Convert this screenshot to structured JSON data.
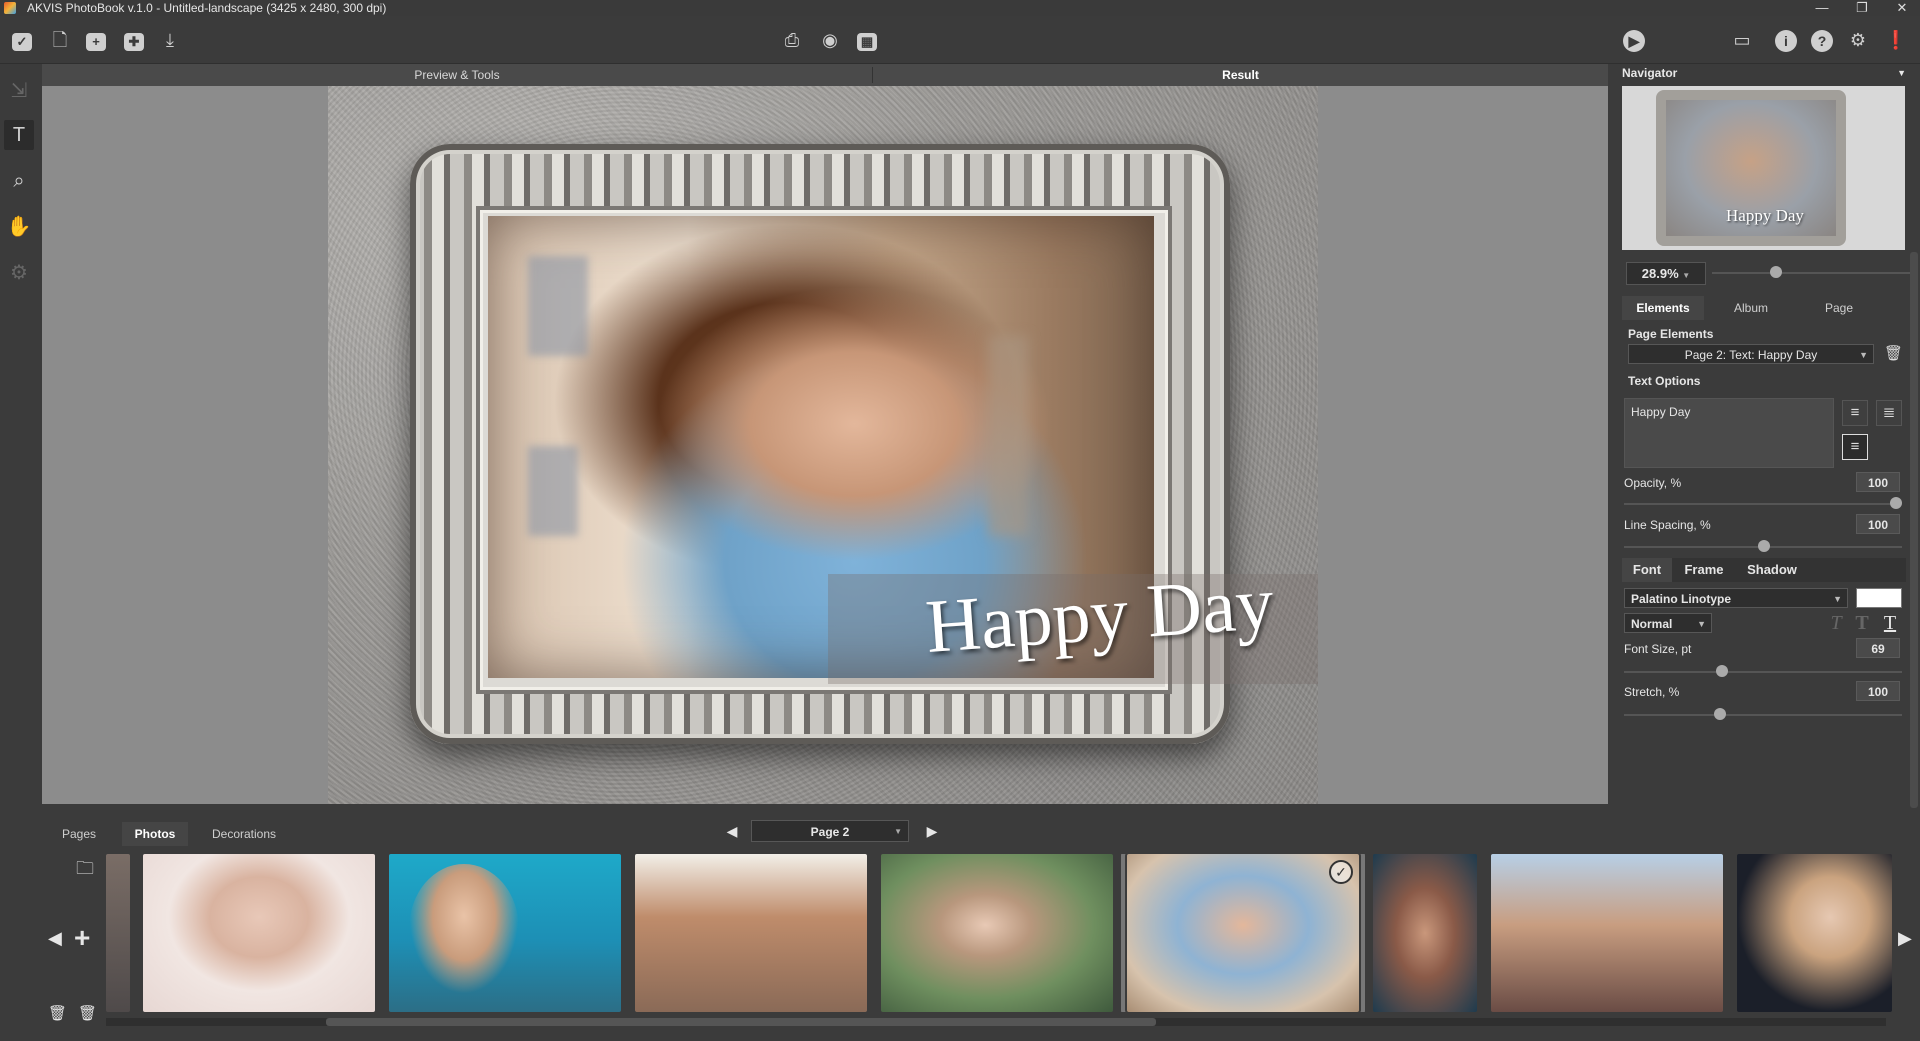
{
  "window": {
    "title": "AKVIS PhotoBook v.1.0 - Untitled-landscape (3425 x 2480, 300 dpi)",
    "minimize": "—",
    "maximize": "❐",
    "close": "✕"
  },
  "toolbar": {
    "left_icons": [
      "akvis-logo-icon",
      "new-document-icon",
      "add-photo-icon",
      "add-decoration-icon",
      "export-icon"
    ],
    "center_icons": [
      "print-icon",
      "preview-icon",
      "book-icon"
    ],
    "right_icons": [
      "run-icon",
      "panels-icon",
      "info-icon",
      "help-icon",
      "settings-icon",
      "notification-icon"
    ]
  },
  "left_tools": [
    "select-tool-icon",
    "text-tool-icon",
    "zoom-tool-icon",
    "hand-tool-icon",
    "gear-tool-icon"
  ],
  "workspace": {
    "tab_preview": "Preview & Tools",
    "tab_result": "Result",
    "caption_text": "Happy Day"
  },
  "navigator": {
    "title": "Navigator",
    "thumb_caption": "Happy Day",
    "zoom": "28.9%"
  },
  "panel": {
    "tabs": [
      "Elements",
      "Album",
      "Page"
    ],
    "page_elements_label": "Page Elements",
    "page_elements_value": "Page 2: Text: Happy Day",
    "text_options_label": "Text Options",
    "text_value": "Happy Day",
    "opacity_label": "Opacity, %",
    "opacity_value": "100",
    "line_spacing_label": "Line Spacing, %",
    "line_spacing_value": "100",
    "subtabs": [
      "Font",
      "Frame",
      "Shadow"
    ],
    "font_family": "Palatino Linotype",
    "font_style": "Normal",
    "font_color": "#ffffff",
    "font_size_label": "Font Size, pt",
    "font_size_value": "69",
    "stretch_label": "Stretch, %",
    "stretch_value": "100",
    "style_glyphs": [
      "T",
      "T",
      "T"
    ]
  },
  "bottom": {
    "tabs": [
      "Pages",
      "Photos",
      "Decorations"
    ],
    "page_selector": "Page 2",
    "prev": "◀",
    "next": "▶"
  },
  "photos": [
    {
      "name": "photo-partial"
    },
    {
      "name": "photo-elderly-woman"
    },
    {
      "name": "photo-girl-icecream"
    },
    {
      "name": "photo-family-house"
    },
    {
      "name": "photo-woman-bench"
    },
    {
      "name": "photo-woman-smiling-selected"
    },
    {
      "name": "photo-woman-headscarf"
    },
    {
      "name": "photo-party-crowd"
    },
    {
      "name": "photo-blonde-girl"
    }
  ]
}
